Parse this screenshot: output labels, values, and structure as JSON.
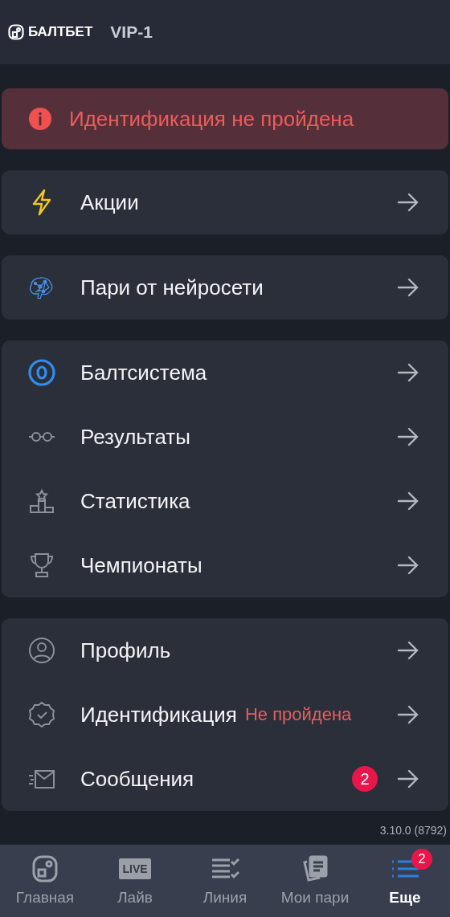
{
  "header": {
    "brand": "БАЛТБЕТ",
    "level": "VIP-1"
  },
  "alert": {
    "text": "Идентификация не пройдена"
  },
  "groups": [
    {
      "items": [
        {
          "kind": "bolt",
          "label": "Акции"
        }
      ]
    },
    {
      "items": [
        {
          "kind": "brain",
          "label": "Пари от нейросети"
        }
      ]
    },
    {
      "items": [
        {
          "kind": "ring",
          "label": "Балтсистема"
        },
        {
          "kind": "glasses",
          "label": "Результаты"
        },
        {
          "kind": "podium",
          "label": "Статистика"
        },
        {
          "kind": "trophy",
          "label": "Чемпионаты"
        }
      ]
    },
    {
      "items": [
        {
          "kind": "user",
          "label": "Профиль"
        },
        {
          "kind": "verified",
          "label": "Идентификация",
          "status": "Не пройдена"
        },
        {
          "kind": "mail",
          "label": "Сообщения",
          "badge": "2"
        }
      ]
    }
  ],
  "version": "3.10.0 (8792)",
  "nav": [
    {
      "kind": "home",
      "label": "Главная",
      "selected": false
    },
    {
      "kind": "live",
      "label": "Лайв",
      "icon_text": "LIVE",
      "selected": false
    },
    {
      "kind": "line",
      "label": "Линия",
      "selected": false
    },
    {
      "kind": "bets",
      "label": "Мои пари",
      "selected": false
    },
    {
      "kind": "more",
      "label": "Еще",
      "badge": "2",
      "selected": true
    }
  ]
}
